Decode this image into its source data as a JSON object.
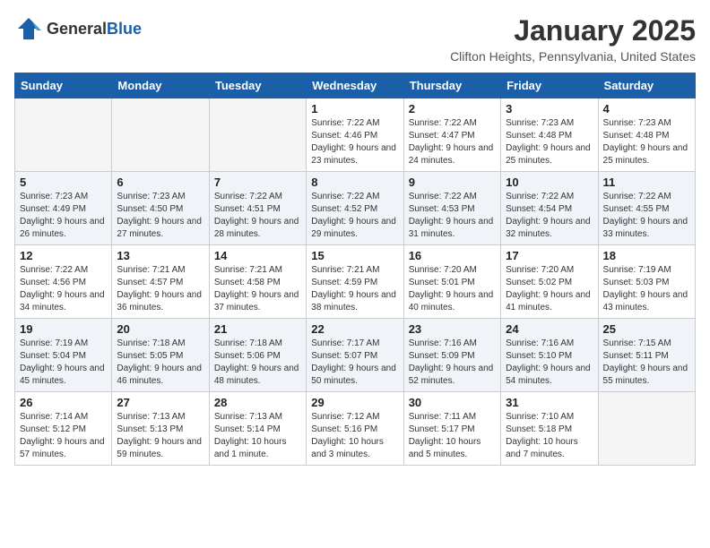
{
  "logo": {
    "general": "General",
    "blue": "Blue"
  },
  "title": "January 2025",
  "location": "Clifton Heights, Pennsylvania, United States",
  "days_of_week": [
    "Sunday",
    "Monday",
    "Tuesday",
    "Wednesday",
    "Thursday",
    "Friday",
    "Saturday"
  ],
  "weeks": [
    [
      {
        "day": "",
        "sunrise": "",
        "sunset": "",
        "daylight": ""
      },
      {
        "day": "",
        "sunrise": "",
        "sunset": "",
        "daylight": ""
      },
      {
        "day": "",
        "sunrise": "",
        "sunset": "",
        "daylight": ""
      },
      {
        "day": "1",
        "sunrise": "Sunrise: 7:22 AM",
        "sunset": "Sunset: 4:46 PM",
        "daylight": "Daylight: 9 hours and 23 minutes."
      },
      {
        "day": "2",
        "sunrise": "Sunrise: 7:22 AM",
        "sunset": "Sunset: 4:47 PM",
        "daylight": "Daylight: 9 hours and 24 minutes."
      },
      {
        "day": "3",
        "sunrise": "Sunrise: 7:23 AM",
        "sunset": "Sunset: 4:48 PM",
        "daylight": "Daylight: 9 hours and 25 minutes."
      },
      {
        "day": "4",
        "sunrise": "Sunrise: 7:23 AM",
        "sunset": "Sunset: 4:48 PM",
        "daylight": "Daylight: 9 hours and 25 minutes."
      }
    ],
    [
      {
        "day": "5",
        "sunrise": "Sunrise: 7:23 AM",
        "sunset": "Sunset: 4:49 PM",
        "daylight": "Daylight: 9 hours and 26 minutes."
      },
      {
        "day": "6",
        "sunrise": "Sunrise: 7:23 AM",
        "sunset": "Sunset: 4:50 PM",
        "daylight": "Daylight: 9 hours and 27 minutes."
      },
      {
        "day": "7",
        "sunrise": "Sunrise: 7:22 AM",
        "sunset": "Sunset: 4:51 PM",
        "daylight": "Daylight: 9 hours and 28 minutes."
      },
      {
        "day": "8",
        "sunrise": "Sunrise: 7:22 AM",
        "sunset": "Sunset: 4:52 PM",
        "daylight": "Daylight: 9 hours and 29 minutes."
      },
      {
        "day": "9",
        "sunrise": "Sunrise: 7:22 AM",
        "sunset": "Sunset: 4:53 PM",
        "daylight": "Daylight: 9 hours and 31 minutes."
      },
      {
        "day": "10",
        "sunrise": "Sunrise: 7:22 AM",
        "sunset": "Sunset: 4:54 PM",
        "daylight": "Daylight: 9 hours and 32 minutes."
      },
      {
        "day": "11",
        "sunrise": "Sunrise: 7:22 AM",
        "sunset": "Sunset: 4:55 PM",
        "daylight": "Daylight: 9 hours and 33 minutes."
      }
    ],
    [
      {
        "day": "12",
        "sunrise": "Sunrise: 7:22 AM",
        "sunset": "Sunset: 4:56 PM",
        "daylight": "Daylight: 9 hours and 34 minutes."
      },
      {
        "day": "13",
        "sunrise": "Sunrise: 7:21 AM",
        "sunset": "Sunset: 4:57 PM",
        "daylight": "Daylight: 9 hours and 36 minutes."
      },
      {
        "day": "14",
        "sunrise": "Sunrise: 7:21 AM",
        "sunset": "Sunset: 4:58 PM",
        "daylight": "Daylight: 9 hours and 37 minutes."
      },
      {
        "day": "15",
        "sunrise": "Sunrise: 7:21 AM",
        "sunset": "Sunset: 4:59 PM",
        "daylight": "Daylight: 9 hours and 38 minutes."
      },
      {
        "day": "16",
        "sunrise": "Sunrise: 7:20 AM",
        "sunset": "Sunset: 5:01 PM",
        "daylight": "Daylight: 9 hours and 40 minutes."
      },
      {
        "day": "17",
        "sunrise": "Sunrise: 7:20 AM",
        "sunset": "Sunset: 5:02 PM",
        "daylight": "Daylight: 9 hours and 41 minutes."
      },
      {
        "day": "18",
        "sunrise": "Sunrise: 7:19 AM",
        "sunset": "Sunset: 5:03 PM",
        "daylight": "Daylight: 9 hours and 43 minutes."
      }
    ],
    [
      {
        "day": "19",
        "sunrise": "Sunrise: 7:19 AM",
        "sunset": "Sunset: 5:04 PM",
        "daylight": "Daylight: 9 hours and 45 minutes."
      },
      {
        "day": "20",
        "sunrise": "Sunrise: 7:18 AM",
        "sunset": "Sunset: 5:05 PM",
        "daylight": "Daylight: 9 hours and 46 minutes."
      },
      {
        "day": "21",
        "sunrise": "Sunrise: 7:18 AM",
        "sunset": "Sunset: 5:06 PM",
        "daylight": "Daylight: 9 hours and 48 minutes."
      },
      {
        "day": "22",
        "sunrise": "Sunrise: 7:17 AM",
        "sunset": "Sunset: 5:07 PM",
        "daylight": "Daylight: 9 hours and 50 minutes."
      },
      {
        "day": "23",
        "sunrise": "Sunrise: 7:16 AM",
        "sunset": "Sunset: 5:09 PM",
        "daylight": "Daylight: 9 hours and 52 minutes."
      },
      {
        "day": "24",
        "sunrise": "Sunrise: 7:16 AM",
        "sunset": "Sunset: 5:10 PM",
        "daylight": "Daylight: 9 hours and 54 minutes."
      },
      {
        "day": "25",
        "sunrise": "Sunrise: 7:15 AM",
        "sunset": "Sunset: 5:11 PM",
        "daylight": "Daylight: 9 hours and 55 minutes."
      }
    ],
    [
      {
        "day": "26",
        "sunrise": "Sunrise: 7:14 AM",
        "sunset": "Sunset: 5:12 PM",
        "daylight": "Daylight: 9 hours and 57 minutes."
      },
      {
        "day": "27",
        "sunrise": "Sunrise: 7:13 AM",
        "sunset": "Sunset: 5:13 PM",
        "daylight": "Daylight: 9 hours and 59 minutes."
      },
      {
        "day": "28",
        "sunrise": "Sunrise: 7:13 AM",
        "sunset": "Sunset: 5:14 PM",
        "daylight": "Daylight: 10 hours and 1 minute."
      },
      {
        "day": "29",
        "sunrise": "Sunrise: 7:12 AM",
        "sunset": "Sunset: 5:16 PM",
        "daylight": "Daylight: 10 hours and 3 minutes."
      },
      {
        "day": "30",
        "sunrise": "Sunrise: 7:11 AM",
        "sunset": "Sunset: 5:17 PM",
        "daylight": "Daylight: 10 hours and 5 minutes."
      },
      {
        "day": "31",
        "sunrise": "Sunrise: 7:10 AM",
        "sunset": "Sunset: 5:18 PM",
        "daylight": "Daylight: 10 hours and 7 minutes."
      },
      {
        "day": "",
        "sunrise": "",
        "sunset": "",
        "daylight": ""
      }
    ]
  ]
}
